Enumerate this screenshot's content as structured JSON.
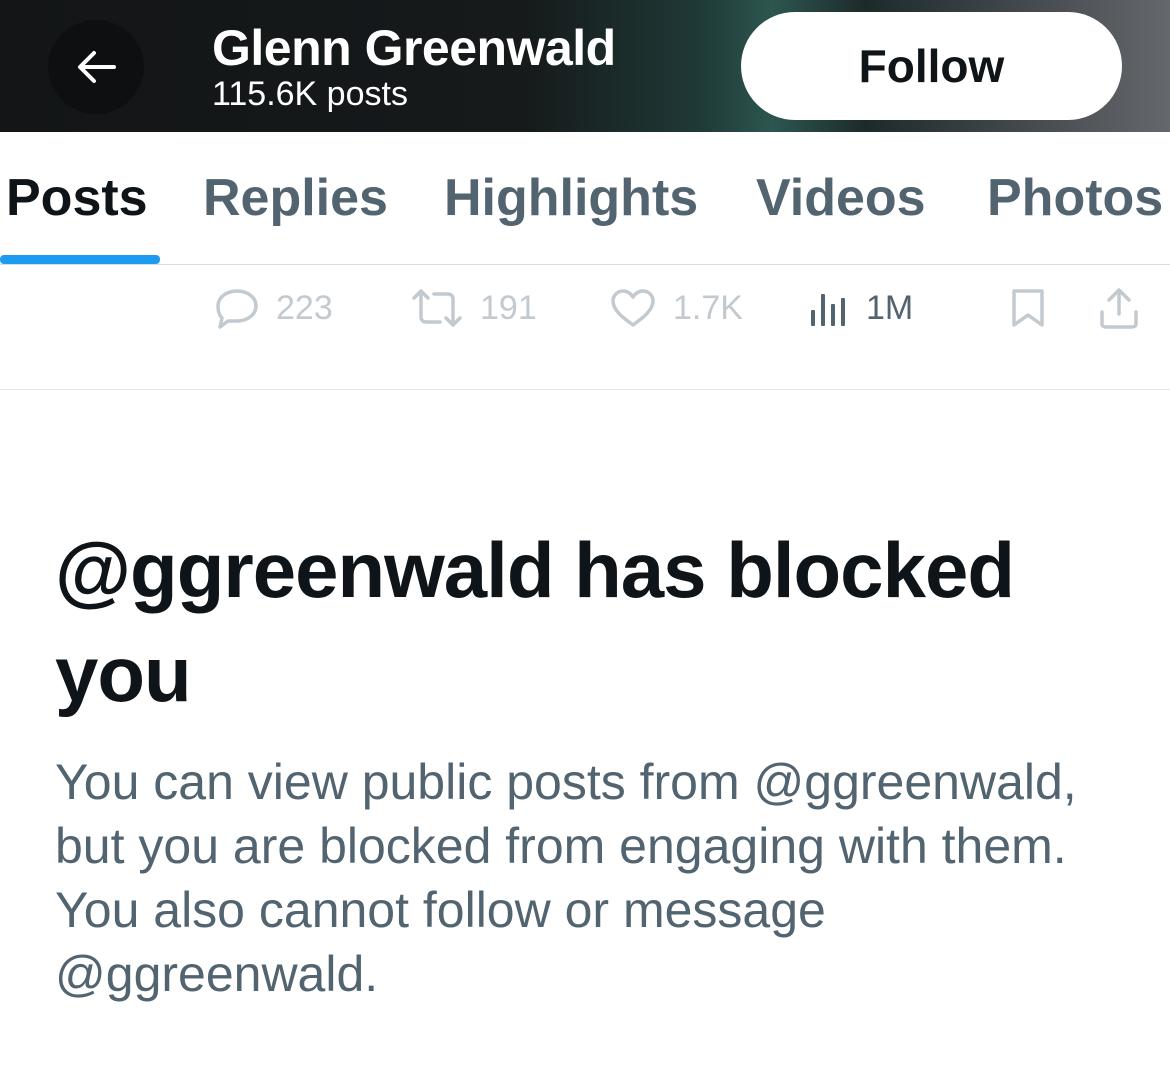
{
  "header": {
    "title": "Glenn Greenwald",
    "post_count": "115.6K posts",
    "follow_label": "Follow",
    "back_icon": "arrow-left-icon"
  },
  "tabs": [
    {
      "label": "Posts",
      "active": true
    },
    {
      "label": "Replies",
      "active": false
    },
    {
      "label": "Highlights",
      "active": false
    },
    {
      "label": "Videos",
      "active": false
    },
    {
      "label": "Photos",
      "active": false
    }
  ],
  "actions": {
    "replies": "223",
    "reposts": "191",
    "likes": "1.7K",
    "views": "1M"
  },
  "blocked": {
    "title": "@ggreenwald has blocked you",
    "body": "You can view public posts from @ggreenwald, but you are blocked from engaging with them. You also cannot follow or message @ggreenwald."
  },
  "colors": {
    "accent": "#1d9bf0",
    "text_primary": "#0f1419",
    "text_secondary": "#536471",
    "disabled": "#c2cad0"
  }
}
